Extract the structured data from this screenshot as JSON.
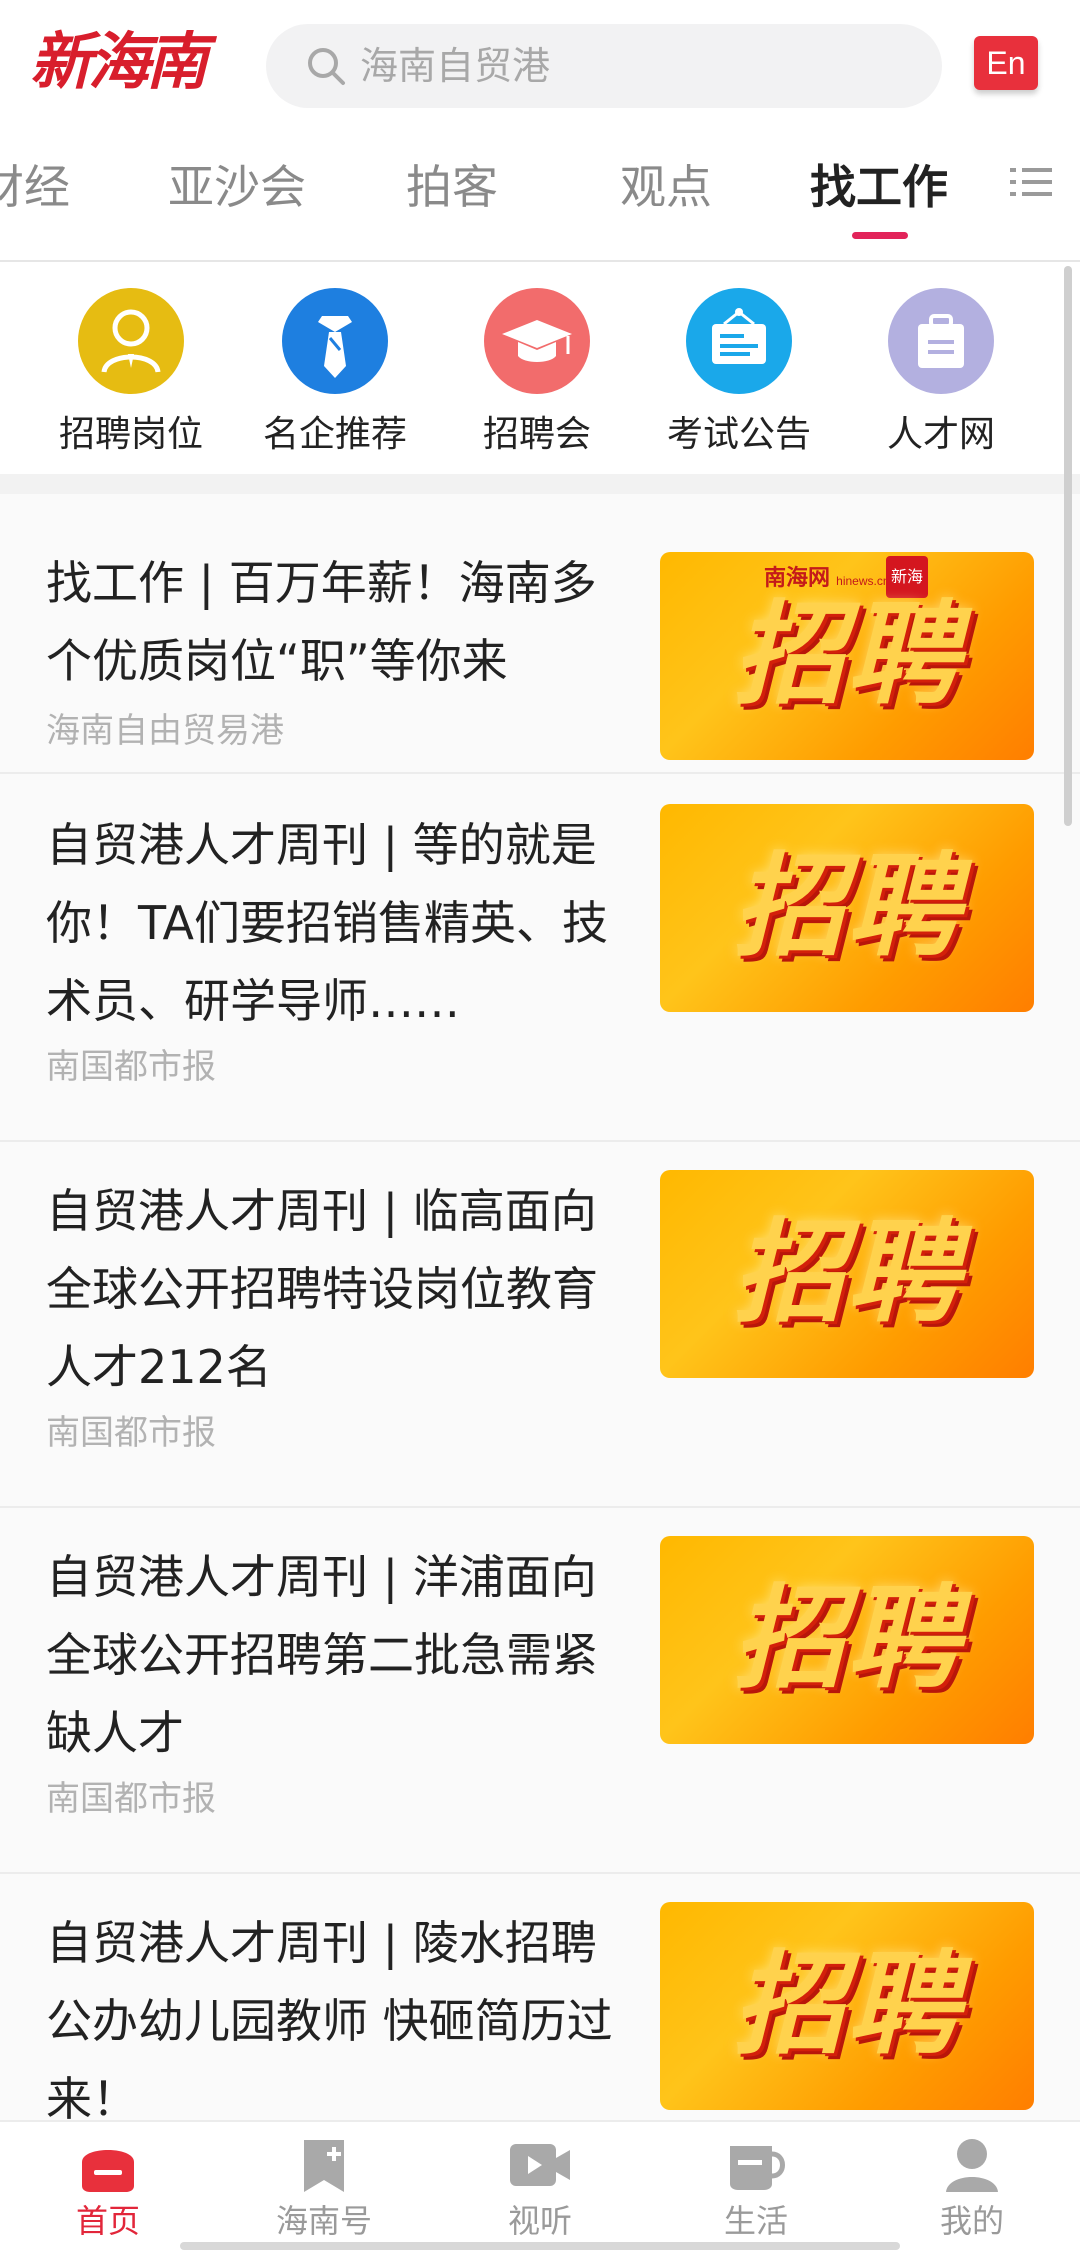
{
  "header": {
    "logo_text": "新海南",
    "search_placeholder": "海南自贸港",
    "lang_button": "En"
  },
  "tabs": [
    {
      "label": "财经"
    },
    {
      "label": "亚沙会"
    },
    {
      "label": "拍客"
    },
    {
      "label": "观点"
    },
    {
      "label": "找工作",
      "active": true
    }
  ],
  "categories": [
    {
      "label": "招聘岗位",
      "icon": "person-icon",
      "color": "#e6bc12"
    },
    {
      "label": "名企推荐",
      "icon": "tie-icon",
      "color": "#1e7fe0"
    },
    {
      "label": "招聘会",
      "icon": "graduation-cap-icon",
      "color": "#f26c6c"
    },
    {
      "label": "考试公告",
      "icon": "notice-board-icon",
      "color": "#1aa8ea"
    },
    {
      "label": "人才网",
      "icon": "briefcase-icon",
      "color": "#b3b0e0"
    }
  ],
  "feed": [
    {
      "title": "找工作 | 百万年薪！海南多个优质岗位“职”等你来",
      "source": "海南自由贸易港",
      "thumb_text": "招聘",
      "thumb_logo": "南海网",
      "thumb_logo_sub": "hinews.cn",
      "thumb_badge": "新海南"
    },
    {
      "title": "自贸港人才周刊 | 等的就是你！TA们要招销售精英、技术员、研学导师……",
      "source": "南国都市报",
      "thumb_text": "招聘"
    },
    {
      "title": "自贸港人才周刊 | 临高面向全球公开招聘特设岗位教育人才212名",
      "source": "南国都市报",
      "thumb_text": "招聘"
    },
    {
      "title": "自贸港人才周刊 | 洋浦面向全球公开招聘第二批急需紧缺人才",
      "source": "南国都市报",
      "thumb_text": "招聘"
    },
    {
      "title": "自贸港人才周刊 | 陵水招聘公办幼儿园教师 快砸简历过来！",
      "source": "",
      "thumb_text": "招聘"
    }
  ],
  "bottom_nav": [
    {
      "label": "首页",
      "icon": "home-icon",
      "active": true
    },
    {
      "label": "海南号",
      "icon": "bookmark-add-icon"
    },
    {
      "label": "视听",
      "icon": "video-icon"
    },
    {
      "label": "生活",
      "icon": "cup-icon"
    },
    {
      "label": "我的",
      "icon": "user-icon"
    }
  ],
  "colors": {
    "brand_red": "#d81e2c",
    "tab_underline": "#e2245a",
    "nav_active": "#e2263a"
  }
}
